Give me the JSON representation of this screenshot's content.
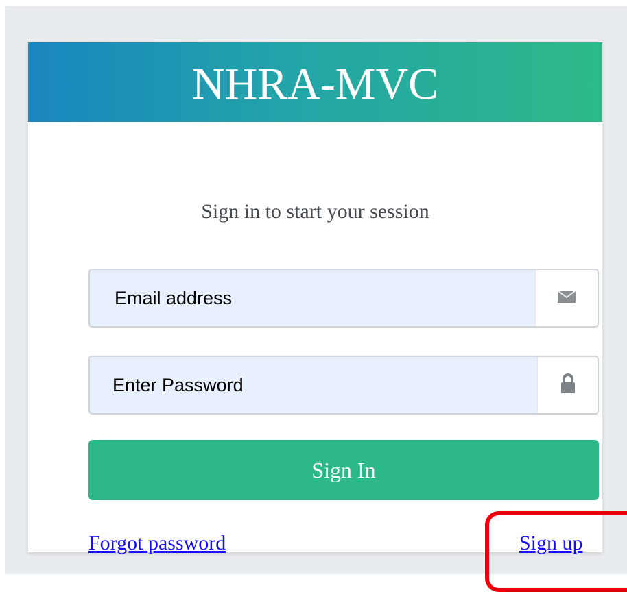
{
  "header": {
    "title": "NHRA-MVC"
  },
  "form": {
    "subtitle": "Sign in to start your session",
    "email": {
      "placeholder": "Email address",
      "value": "",
      "icon": "envelope-icon"
    },
    "password": {
      "placeholder": "Enter Password",
      "value": "",
      "icon": "lock-icon"
    },
    "submit_label": "Sign In"
  },
  "links": {
    "forgot_password": "Forgot password",
    "sign_up": "Sign up"
  },
  "colors": {
    "header_gradient_start": "#1a86bf",
    "header_gradient_end": "#2dba88",
    "button_green": "#2cb987",
    "link_blue": "#1a0dff",
    "input_fill": "#e8f0fe",
    "highlight_red": "#e8000b"
  }
}
